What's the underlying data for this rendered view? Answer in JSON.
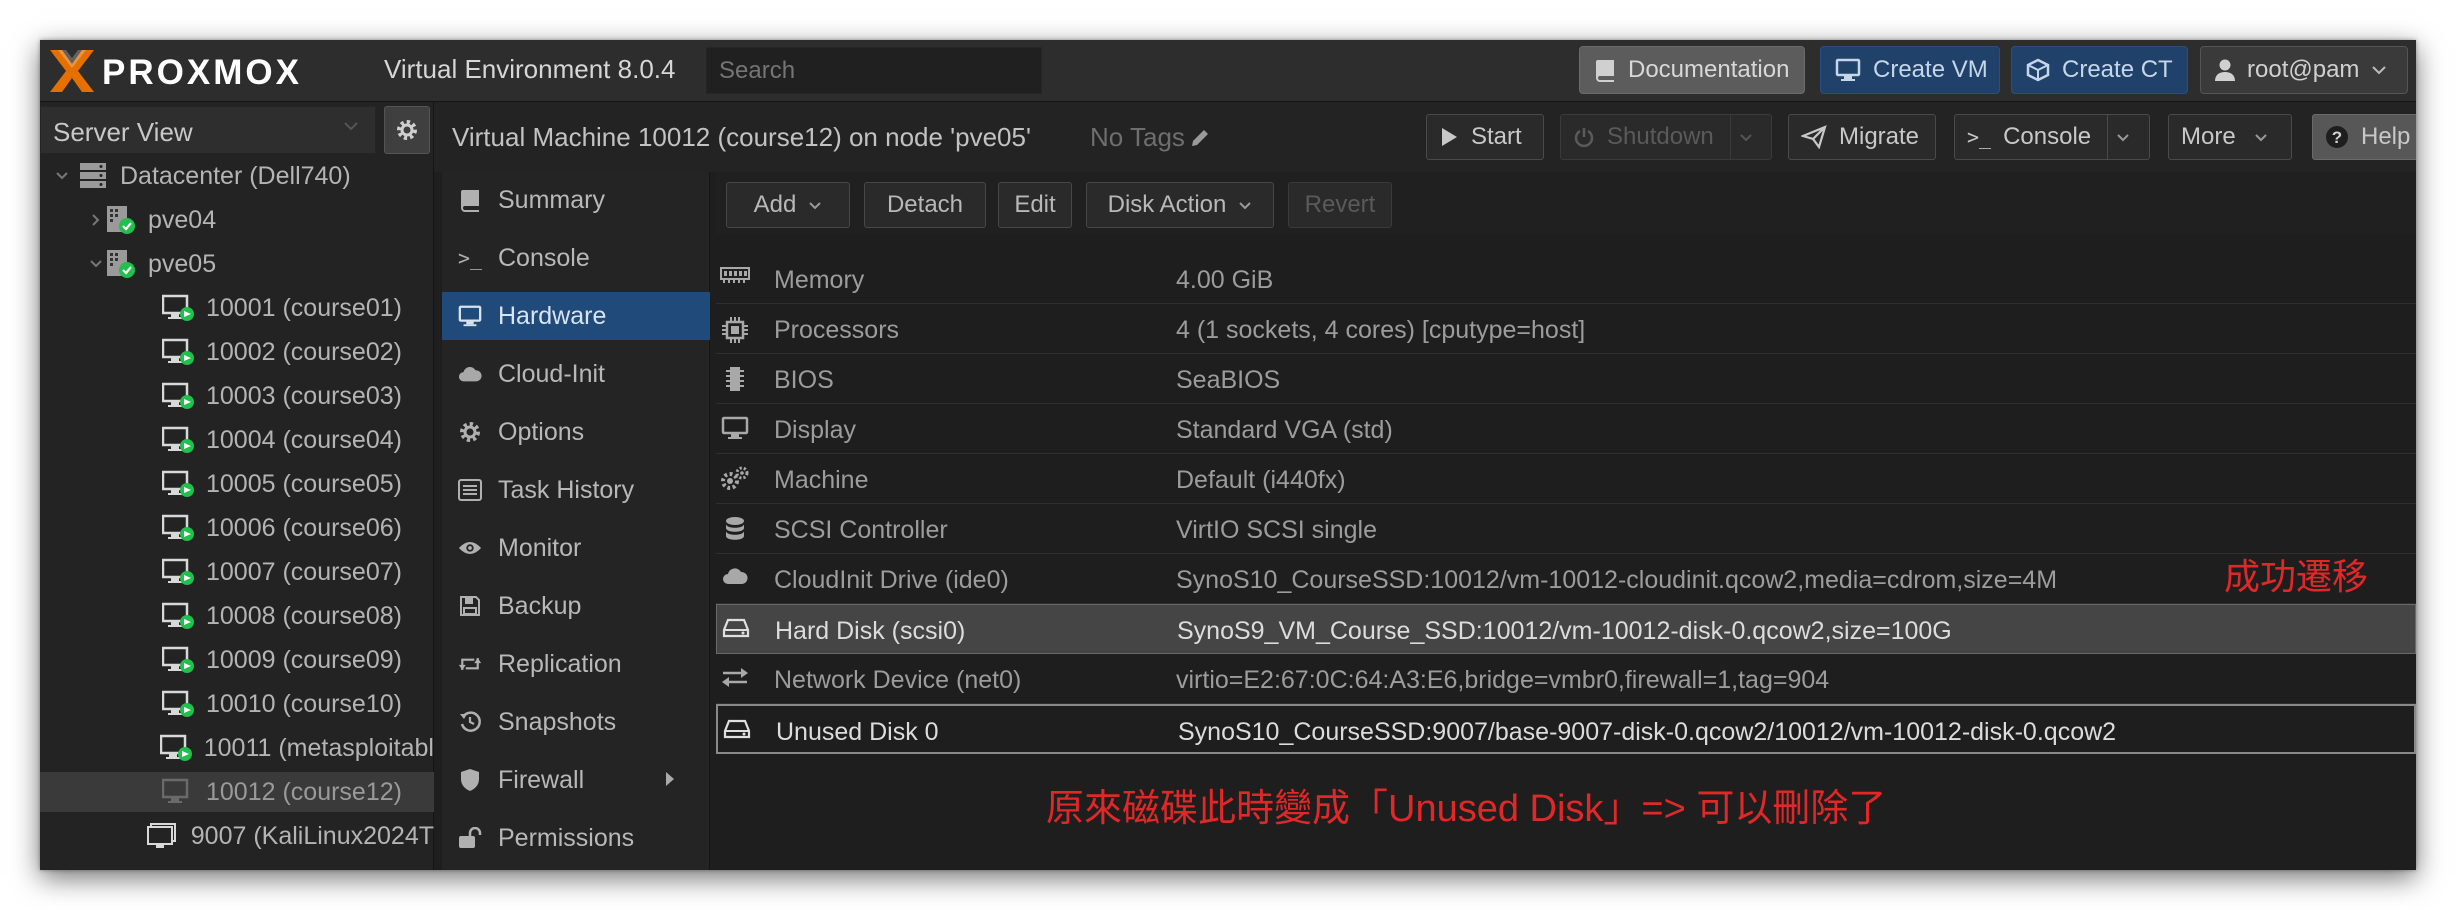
{
  "header": {
    "logo_text": "PROXMOX",
    "version": "Virtual Environment 8.0.4",
    "search_placeholder": "Search",
    "buttons": {
      "documentation": "Documentation",
      "create_vm": "Create VM",
      "create_ct": "Create CT",
      "user": "root@pam"
    }
  },
  "tree": {
    "view": "Server View",
    "nodes": [
      {
        "label": "Datacenter (Dell740)",
        "icon": "datacenter-icon"
      },
      {
        "label": "pve04",
        "icon": "node-online-icon"
      },
      {
        "label": "pve05",
        "icon": "node-online-icon"
      },
      {
        "label": "10001 (course01)",
        "icon": "vm-running-icon"
      },
      {
        "label": "10002 (course02)",
        "icon": "vm-running-icon"
      },
      {
        "label": "10003 (course03)",
        "icon": "vm-running-icon"
      },
      {
        "label": "10004 (course04)",
        "icon": "vm-running-icon"
      },
      {
        "label": "10005 (course05)",
        "icon": "vm-running-icon"
      },
      {
        "label": "10006 (course06)",
        "icon": "vm-running-icon"
      },
      {
        "label": "10007 (course07)",
        "icon": "vm-running-icon"
      },
      {
        "label": "10008 (course08)",
        "icon": "vm-running-icon"
      },
      {
        "label": "10009 (course09)",
        "icon": "vm-running-icon"
      },
      {
        "label": "10010 (course10)",
        "icon": "vm-running-icon"
      },
      {
        "label": "10011 (metasploitabl",
        "icon": "vm-running-icon"
      },
      {
        "label": "10012 (course12)",
        "icon": "vm-stopped-icon"
      },
      {
        "label": "9007 (KaliLinux2024T",
        "icon": "template-icon"
      }
    ]
  },
  "vm": {
    "title": "Virtual Machine 10012 (course12) on node 'pve05'",
    "tags": "No Tags",
    "toolbar": {
      "start": "Start",
      "shutdown": "Shutdown",
      "migrate": "Migrate",
      "console": "Console",
      "more": "More",
      "help": "Help"
    }
  },
  "nav": [
    {
      "label": "Summary",
      "icon": "book-icon"
    },
    {
      "label": "Console",
      "icon": "terminal-icon"
    },
    {
      "label": "Hardware",
      "icon": "monitor-icon",
      "active": true
    },
    {
      "label": "Cloud-Init",
      "icon": "cloud-icon"
    },
    {
      "label": "Options",
      "icon": "gear-icon"
    },
    {
      "label": "Task History",
      "icon": "list-icon"
    },
    {
      "label": "Monitor",
      "icon": "eye-icon"
    },
    {
      "label": "Backup",
      "icon": "floppy-icon"
    },
    {
      "label": "Replication",
      "icon": "retweet-icon"
    },
    {
      "label": "Snapshots",
      "icon": "history-icon"
    },
    {
      "label": "Firewall",
      "icon": "shield-icon"
    },
    {
      "label": "Permissions",
      "icon": "unlock-icon"
    }
  ],
  "hardware_toolbar": {
    "add": "Add",
    "detach": "Detach",
    "edit": "Edit",
    "disk_action": "Disk Action",
    "revert": "Revert"
  },
  "hardware": [
    {
      "key": "Memory",
      "value": "4.00 GiB",
      "icon": "memory-icon"
    },
    {
      "key": "Processors",
      "value": "4 (1 sockets, 4 cores) [cputype=host]",
      "icon": "cpu-icon"
    },
    {
      "key": "BIOS",
      "value": "SeaBIOS",
      "icon": "microchip-icon"
    },
    {
      "key": "Display",
      "value": "Standard VGA (std)",
      "icon": "desktop-icon"
    },
    {
      "key": "Machine",
      "value": "Default (i440fx)",
      "icon": "cogs-icon"
    },
    {
      "key": "SCSI Controller",
      "value": "VirtIO SCSI single",
      "icon": "database-icon"
    },
    {
      "key": "CloudInit Drive (ide0)",
      "value": "SynoS10_CourseSSD:10012/vm-10012-cloudinit.qcow2,media=cdrom,size=4M",
      "icon": "cloud-icon"
    },
    {
      "key": "Hard Disk (scsi0)",
      "value": "SynoS9_VM_Course_SSD:10012/vm-10012-disk-0.qcow2,size=100G",
      "icon": "hdd-icon"
    },
    {
      "key": "Network Device (net0)",
      "value": "virtio=E2:67:0C:64:A3:E6,bridge=vmbr0,firewall=1,tag=904",
      "icon": "exchange-icon"
    },
    {
      "key": "Unused Disk 0",
      "value": "SynoS10_CourseSSD:9007/base-9007-disk-0.qcow2/10012/vm-10012-disk-0.qcow2",
      "icon": "hdd-icon"
    }
  ],
  "annotations": {
    "migrated": "成功遷移",
    "note": "原來磁碟此時變成「Unused Disk」=> 可以刪除了"
  },
  "colors": {
    "accent_blue": "#1f4a7a",
    "annotation_red": "#e02828",
    "status_green": "#21bf4b",
    "logo_orange": "#e57000"
  }
}
